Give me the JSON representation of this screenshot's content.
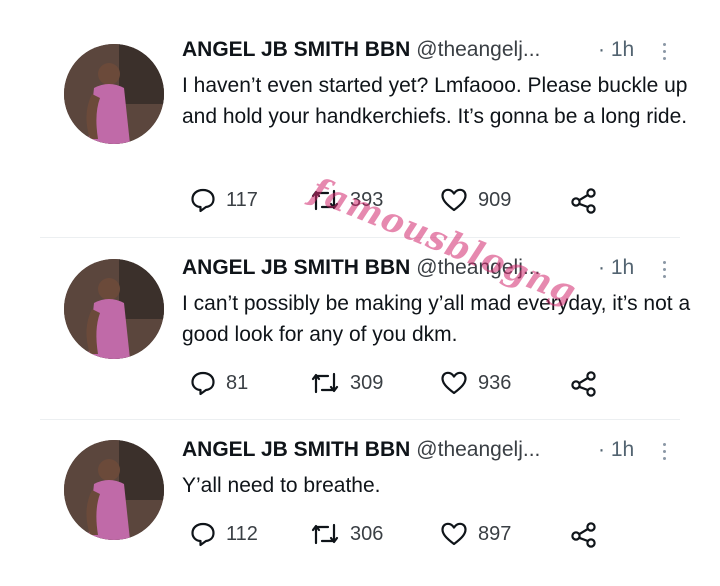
{
  "watermark": "famousblogng",
  "tweets": [
    {
      "name": "ANGEL JB SMITH BBN",
      "handle": "@theangelj...",
      "time": "· 1h",
      "text": "I haven’t even started yet? Lmfaooo. Please buckle up and hold your handkerchiefs. It’s gonna be a long ride.",
      "replies": "117",
      "retweets": "393",
      "likes": "909"
    },
    {
      "name": "ANGEL JB SMITH BBN",
      "handle": "@theangelj...",
      "time": "· 1h",
      "text": "I can’t possibly be making y’all mad everyday, it’s not a good look for any of you dkm.",
      "replies": "81",
      "retweets": "309",
      "likes": "936"
    },
    {
      "name": "ANGEL JB SMITH BBN",
      "handle": "@theangelj...",
      "time": "· 1h",
      "text": "Y’all need to breathe.",
      "replies": "112",
      "retweets": "306",
      "likes": "897"
    }
  ]
}
